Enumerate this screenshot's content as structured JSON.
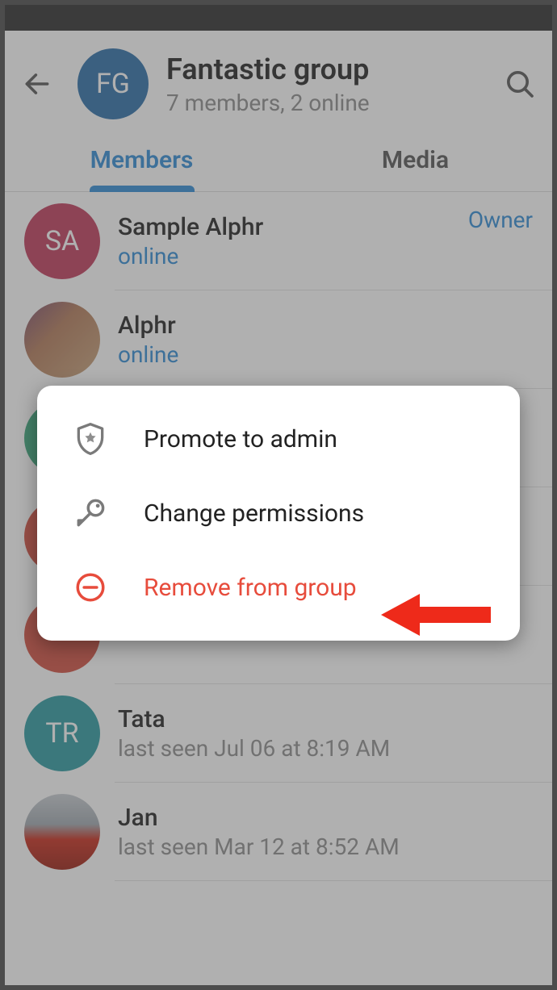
{
  "header": {
    "avatar_initials": "FG",
    "title": "Fantastic group",
    "subtitle": "7 members, 2 online"
  },
  "tabs": {
    "members": "Members",
    "media": "Media"
  },
  "members": [
    {
      "initials": "SA",
      "name": "Sample Alphr",
      "status": "online",
      "status_online": true,
      "role": "Owner",
      "avatar_class": "sa"
    },
    {
      "initials": "",
      "name": "Alphr",
      "status": "online",
      "status_online": true,
      "role": "",
      "avatar_class": "photo1"
    },
    {
      "initials": "",
      "name": "",
      "status": "",
      "status_online": false,
      "role": "",
      "avatar_class": "green"
    },
    {
      "initials": "",
      "name": "",
      "status": "",
      "status_online": false,
      "role": "",
      "avatar_class": "red"
    },
    {
      "initials": "",
      "name": "",
      "status": "",
      "status_online": false,
      "role": "",
      "avatar_class": "red"
    },
    {
      "initials": "TR",
      "name": "Tata",
      "status": "last seen Jul 06 at 8:19 AM",
      "status_online": false,
      "role": "",
      "avatar_class": "tr"
    },
    {
      "initials": "",
      "name": "Jan",
      "status": "last seen Mar 12 at 8:52 AM",
      "status_online": false,
      "role": "",
      "avatar_class": "car"
    }
  ],
  "popup": {
    "promote": "Promote to admin",
    "permissions": "Change permissions",
    "remove": "Remove from group"
  }
}
